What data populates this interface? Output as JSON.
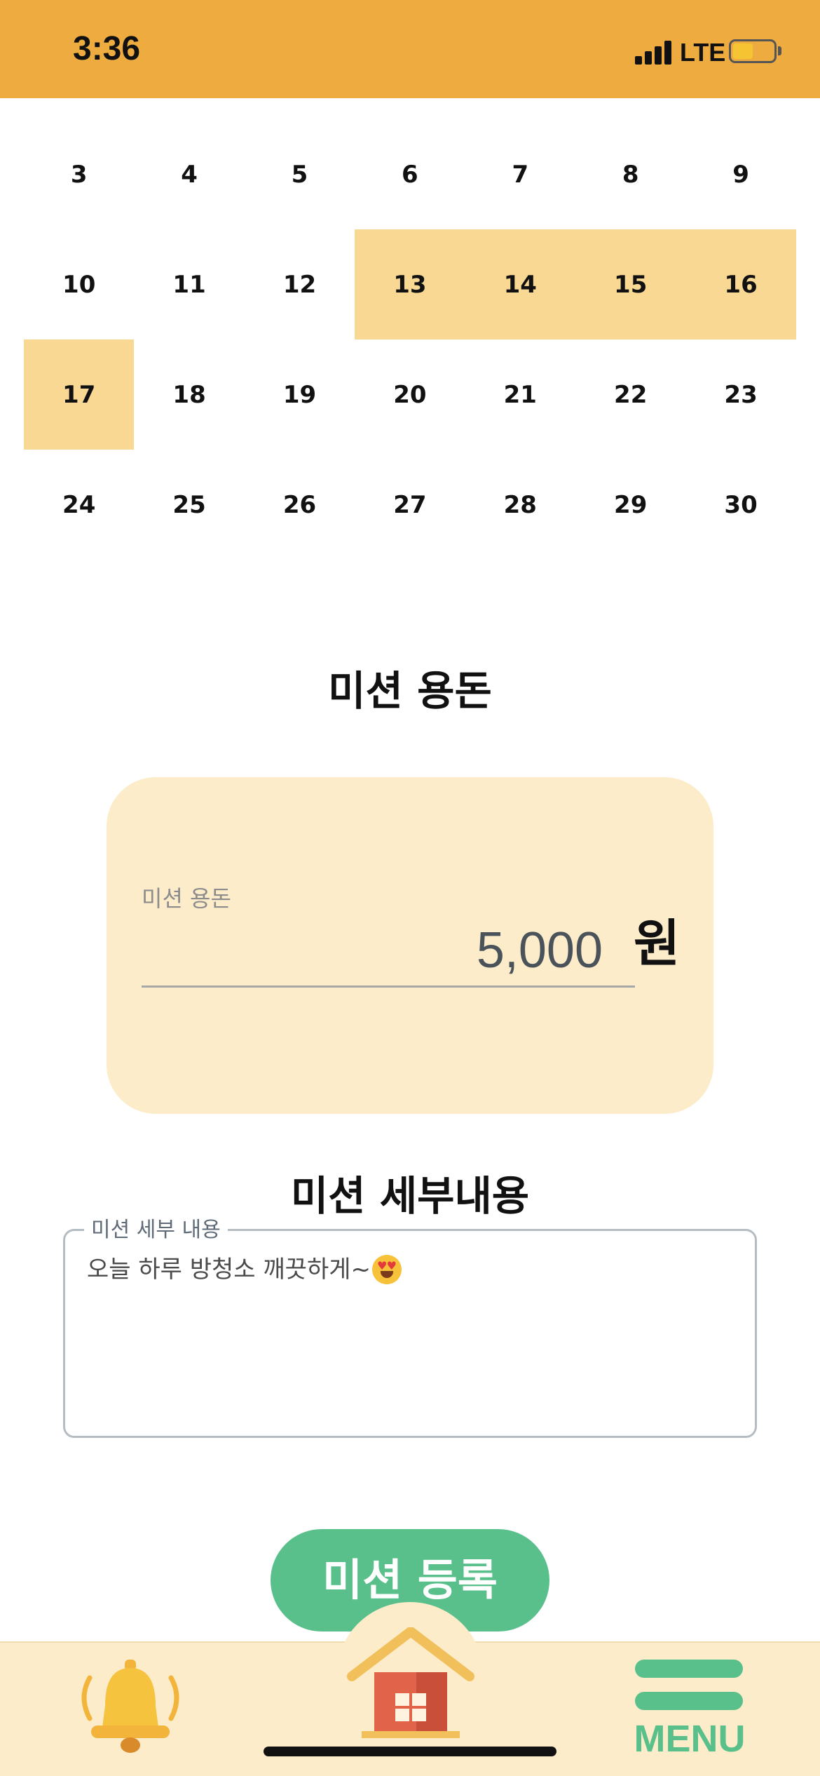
{
  "status_bar": {
    "time": "3:36",
    "network": "LTE"
  },
  "calendar": {
    "rows": [
      [
        {
          "day": "3",
          "highlighted": false
        },
        {
          "day": "4",
          "highlighted": false
        },
        {
          "day": "5",
          "highlighted": false
        },
        {
          "day": "6",
          "highlighted": false
        },
        {
          "day": "7",
          "highlighted": false
        },
        {
          "day": "8",
          "highlighted": false
        },
        {
          "day": "9",
          "highlighted": false
        }
      ],
      [
        {
          "day": "10",
          "highlighted": false
        },
        {
          "day": "11",
          "highlighted": false
        },
        {
          "day": "12",
          "highlighted": false
        },
        {
          "day": "13",
          "highlighted": true
        },
        {
          "day": "14",
          "highlighted": true
        },
        {
          "day": "15",
          "highlighted": true
        },
        {
          "day": "16",
          "highlighted": true
        }
      ],
      [
        {
          "day": "17",
          "highlighted": true
        },
        {
          "day": "18",
          "highlighted": false
        },
        {
          "day": "19",
          "highlighted": false
        },
        {
          "day": "20",
          "highlighted": false
        },
        {
          "day": "21",
          "highlighted": false
        },
        {
          "day": "22",
          "highlighted": false
        },
        {
          "day": "23",
          "highlighted": false
        }
      ],
      [
        {
          "day": "24",
          "highlighted": false
        },
        {
          "day": "25",
          "highlighted": false
        },
        {
          "day": "26",
          "highlighted": false
        },
        {
          "day": "27",
          "highlighted": false
        },
        {
          "day": "28",
          "highlighted": false
        },
        {
          "day": "29",
          "highlighted": false
        },
        {
          "day": "30",
          "highlighted": false
        }
      ]
    ]
  },
  "allowance": {
    "section_title": "미션 용돈",
    "field_label": "미션 용돈",
    "value": "5,000",
    "unit": "원"
  },
  "details": {
    "section_title": "미션 세부내용",
    "field_label": "미션 세부 내용",
    "text": "오늘 하루 방청소 깨끗하게~",
    "emoji": "heart-eyes-emoji"
  },
  "register_button": {
    "label": "미션 등록"
  },
  "bottom_nav": {
    "left_icon": "bell-icon",
    "center_icon": "home-icon",
    "menu_label": "MENU"
  },
  "colors": {
    "status_bar": "#eeab3f",
    "highlight": "#f8d892",
    "card": "#fcecca",
    "accent_green": "#5ac08b"
  }
}
